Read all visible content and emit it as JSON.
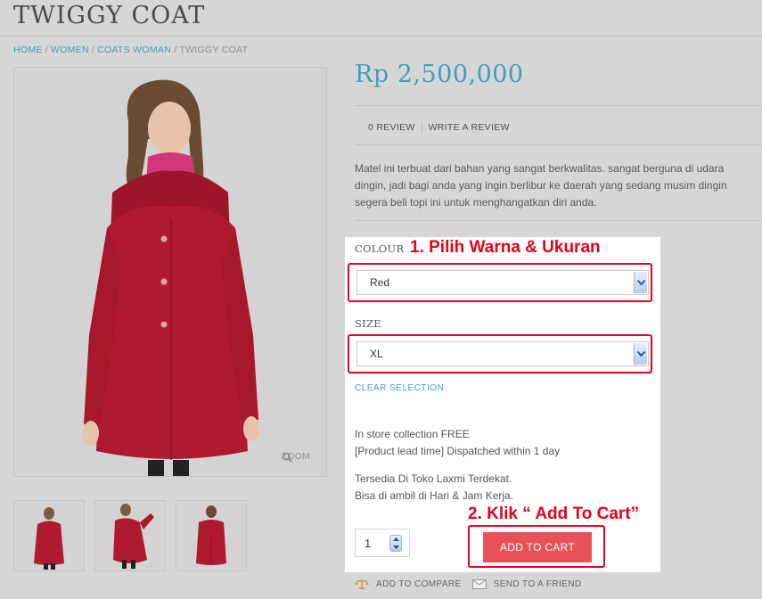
{
  "product": {
    "title": "TWIGGY COAT",
    "price": "Rp 2,500,000",
    "description": "Matel ini terbuat dari bahan yang sangat berkwalitas. sangat berguna di udara dingin, jadi bagi anda yang ingin berlibur ke daerah yang sedang musim dingin segera beli topi ini untuk menghangatkan diri anda.",
    "zoom_label": "ZOOM"
  },
  "breadcrumb": {
    "home": "HOME",
    "women": "WOMEN",
    "coats": "COATS WOMAN",
    "current": "TWIGGY COAT",
    "separator": "/"
  },
  "reviews": {
    "count_label": "0 REVIEW",
    "write_label": "WRITE A REVIEW"
  },
  "options": {
    "colour_label": "COLOUR",
    "colour_value": "Red",
    "size_label": "SIZE",
    "size_value": "XL",
    "clear_label": "CLEAR SELECTION"
  },
  "annotations": {
    "step1": "1. Pilih Warna & Ukuran",
    "step2": "2. Klik “ Add To Cart”"
  },
  "shipping": {
    "line1": "In store collection FREE",
    "line2": "[Product lead time] Dispatched within 1 day",
    "line3": "Tersedia Di Toko Laxmi Terdekat.",
    "line4": "Bisa di ambil di Hari & Jam Kerja."
  },
  "cart": {
    "quantity": "1",
    "button_label": "ADD TO CART"
  },
  "actions": {
    "compare": "ADD TO COMPARE",
    "friend": "SEND TO A FRIEND"
  },
  "colors": {
    "accent": "#3f9fb8",
    "cart_button": "#e8505a",
    "annotation_red": "#e8001a",
    "coat_red": "#b01a30"
  }
}
